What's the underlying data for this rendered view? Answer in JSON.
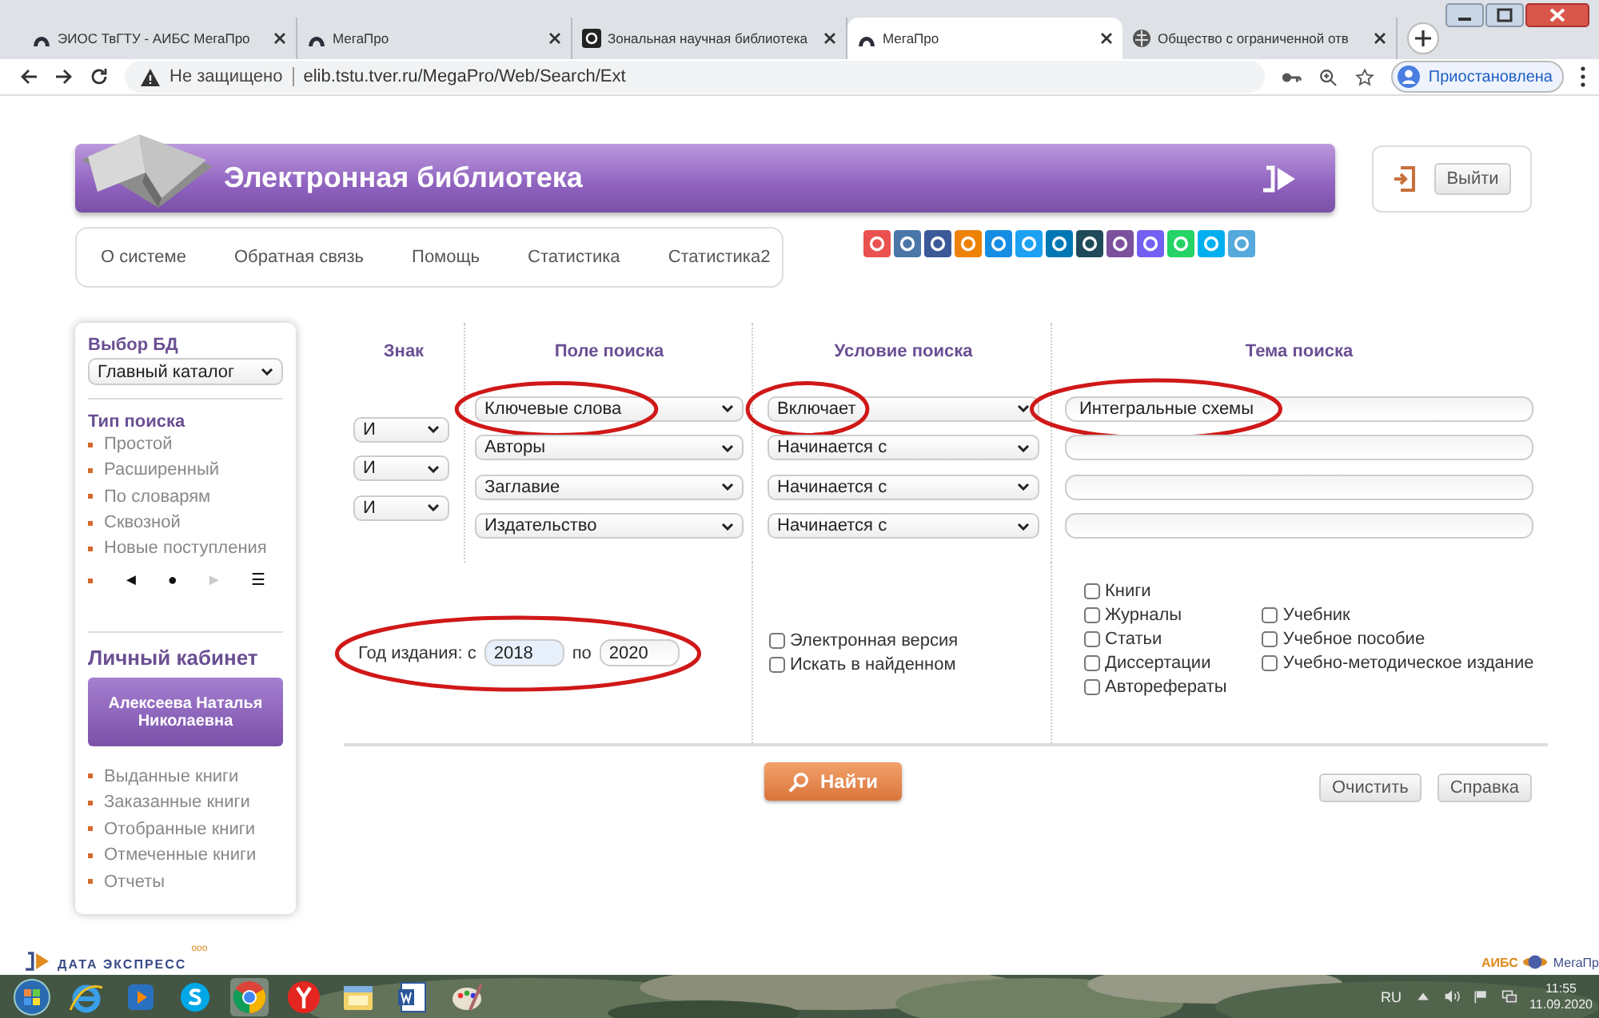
{
  "browser": {
    "tabs": [
      {
        "title": "ЭИОС ТвГТУ - АИБС МегаПро",
        "kind": "arch",
        "selected": false
      },
      {
        "title": "МегаПро",
        "kind": "arch",
        "selected": false
      },
      {
        "title": "Зональная научная библиотека",
        "kind": "library",
        "selected": false
      },
      {
        "title": "МегаПро",
        "kind": "arch",
        "selected": true
      },
      {
        "title": "Общество с ограниченной отв",
        "kind": "globe",
        "selected": false
      }
    ],
    "security": "Не защищено",
    "url": "elib.tstu.tver.ru/MegaPro/Web/Search/Ext",
    "profile": "Приостановлена"
  },
  "header": {
    "title": "Электронная библиотека",
    "logout": "Выйти"
  },
  "nav": [
    "О системе",
    "Обратная связь",
    "Помощь",
    "Статистика",
    "Статистика2"
  ],
  "share_buttons": [
    {
      "color": "#e9524f"
    },
    {
      "color": "#4a76a8"
    },
    {
      "color": "#3b5998"
    },
    {
      "color": "#ee8208"
    },
    {
      "color": "#168de2"
    },
    {
      "color": "#1da1f2"
    },
    {
      "color": "#0077b5"
    },
    {
      "color": "#1f4a5a"
    },
    {
      "color": "#7b519d"
    },
    {
      "color": "#7360f2"
    },
    {
      "color": "#25d366"
    },
    {
      "color": "#00aff0"
    },
    {
      "color": "#56a9db"
    }
  ],
  "sidebar": {
    "db_heading": "Выбор БД",
    "db": "Главный каталог",
    "search_type_heading": "Тип поиска",
    "search_types": [
      "Простой",
      "Расширенный",
      "По словарям",
      "Сквозной",
      "Новые поступления"
    ],
    "pager": [
      {
        "symbol": "◄",
        "disabled": false
      },
      {
        "symbol": "●",
        "disabled": false
      },
      {
        "symbol": "►",
        "disabled": true
      },
      {
        "symbol": "☰",
        "disabled": false
      }
    ],
    "cabinet_heading": "Личный кабинет",
    "user": "Алексеева Наталья Николаевна",
    "cabinet_links": [
      "Выданные книги",
      "Заказанные книги",
      "Отобранные книги",
      "Отмеченные книги",
      "Отчеты"
    ]
  },
  "form": {
    "headings": [
      "Знак",
      "Поле поиска",
      "Условие поиска",
      "Тема поиска"
    ],
    "operators": [
      "И",
      "И",
      "И"
    ],
    "rows": [
      {
        "field": {
          "value": "Ключевые слова",
          "circled": true
        },
        "condition": {
          "value": "Включает",
          "circled": true
        },
        "term": {
          "value": "Интегральные схемы",
          "circled": true
        }
      },
      {
        "field": {
          "value": "Авторы",
          "circled": false
        },
        "condition": {
          "value": "Начинается с",
          "circled": false
        },
        "term": {
          "circled": false
        }
      },
      {
        "field": {
          "value": "Заглавие",
          "circled": false
        },
        "condition": {
          "value": "Начинается с",
          "circled": false
        },
        "term": {
          "circled": false
        }
      },
      {
        "field": {
          "value": "Издательство",
          "circled": false
        },
        "condition": {
          "value": "Начинается с",
          "circled": false
        },
        "term": {
          "circled": false
        }
      }
    ],
    "year": {
      "label": "Год издания: с",
      "from": "2018",
      "to_label": "по",
      "to": "2020",
      "circled": true
    },
    "options": [
      {
        "label": "Электронная версия",
        "checked": false
      },
      {
        "label": "Искать в найденном",
        "checked": false
      }
    ],
    "doc_types": [
      [
        {
          "label": "Книги",
          "checked": false
        },
        {
          "label": "Журналы",
          "checked": false
        },
        {
          "label": "Статьи",
          "checked": false
        },
        {
          "label": "Диссертации",
          "checked": false
        },
        {
          "label": "Авторефераты",
          "checked": false
        }
      ],
      [
        {
          "label": "Учебник",
          "checked": false
        },
        {
          "label": "Учебное пособие",
          "checked": false
        },
        {
          "label": "Учебно-методическое издание",
          "checked": false
        }
      ]
    ],
    "search_button": "Найти",
    "clear_button": "Очистить",
    "help_button": "Справка"
  },
  "footer": {
    "vendor_mark": "ооо",
    "vendor": "ДАТА ЭКСПРЕСС",
    "product_label": "АИБС",
    "product": "МегаПр"
  },
  "taskbar": {
    "apps": [
      {
        "kind": "start"
      },
      {
        "kind": "ie"
      },
      {
        "kind": "media"
      },
      {
        "kind": "skype"
      },
      {
        "kind": "chrome"
      },
      {
        "kind": "yandex"
      },
      {
        "kind": "explorer"
      },
      {
        "kind": "word"
      },
      {
        "kind": "paint"
      }
    ],
    "language": "RU",
    "time": "11:55",
    "date": "11.09.2020"
  }
}
